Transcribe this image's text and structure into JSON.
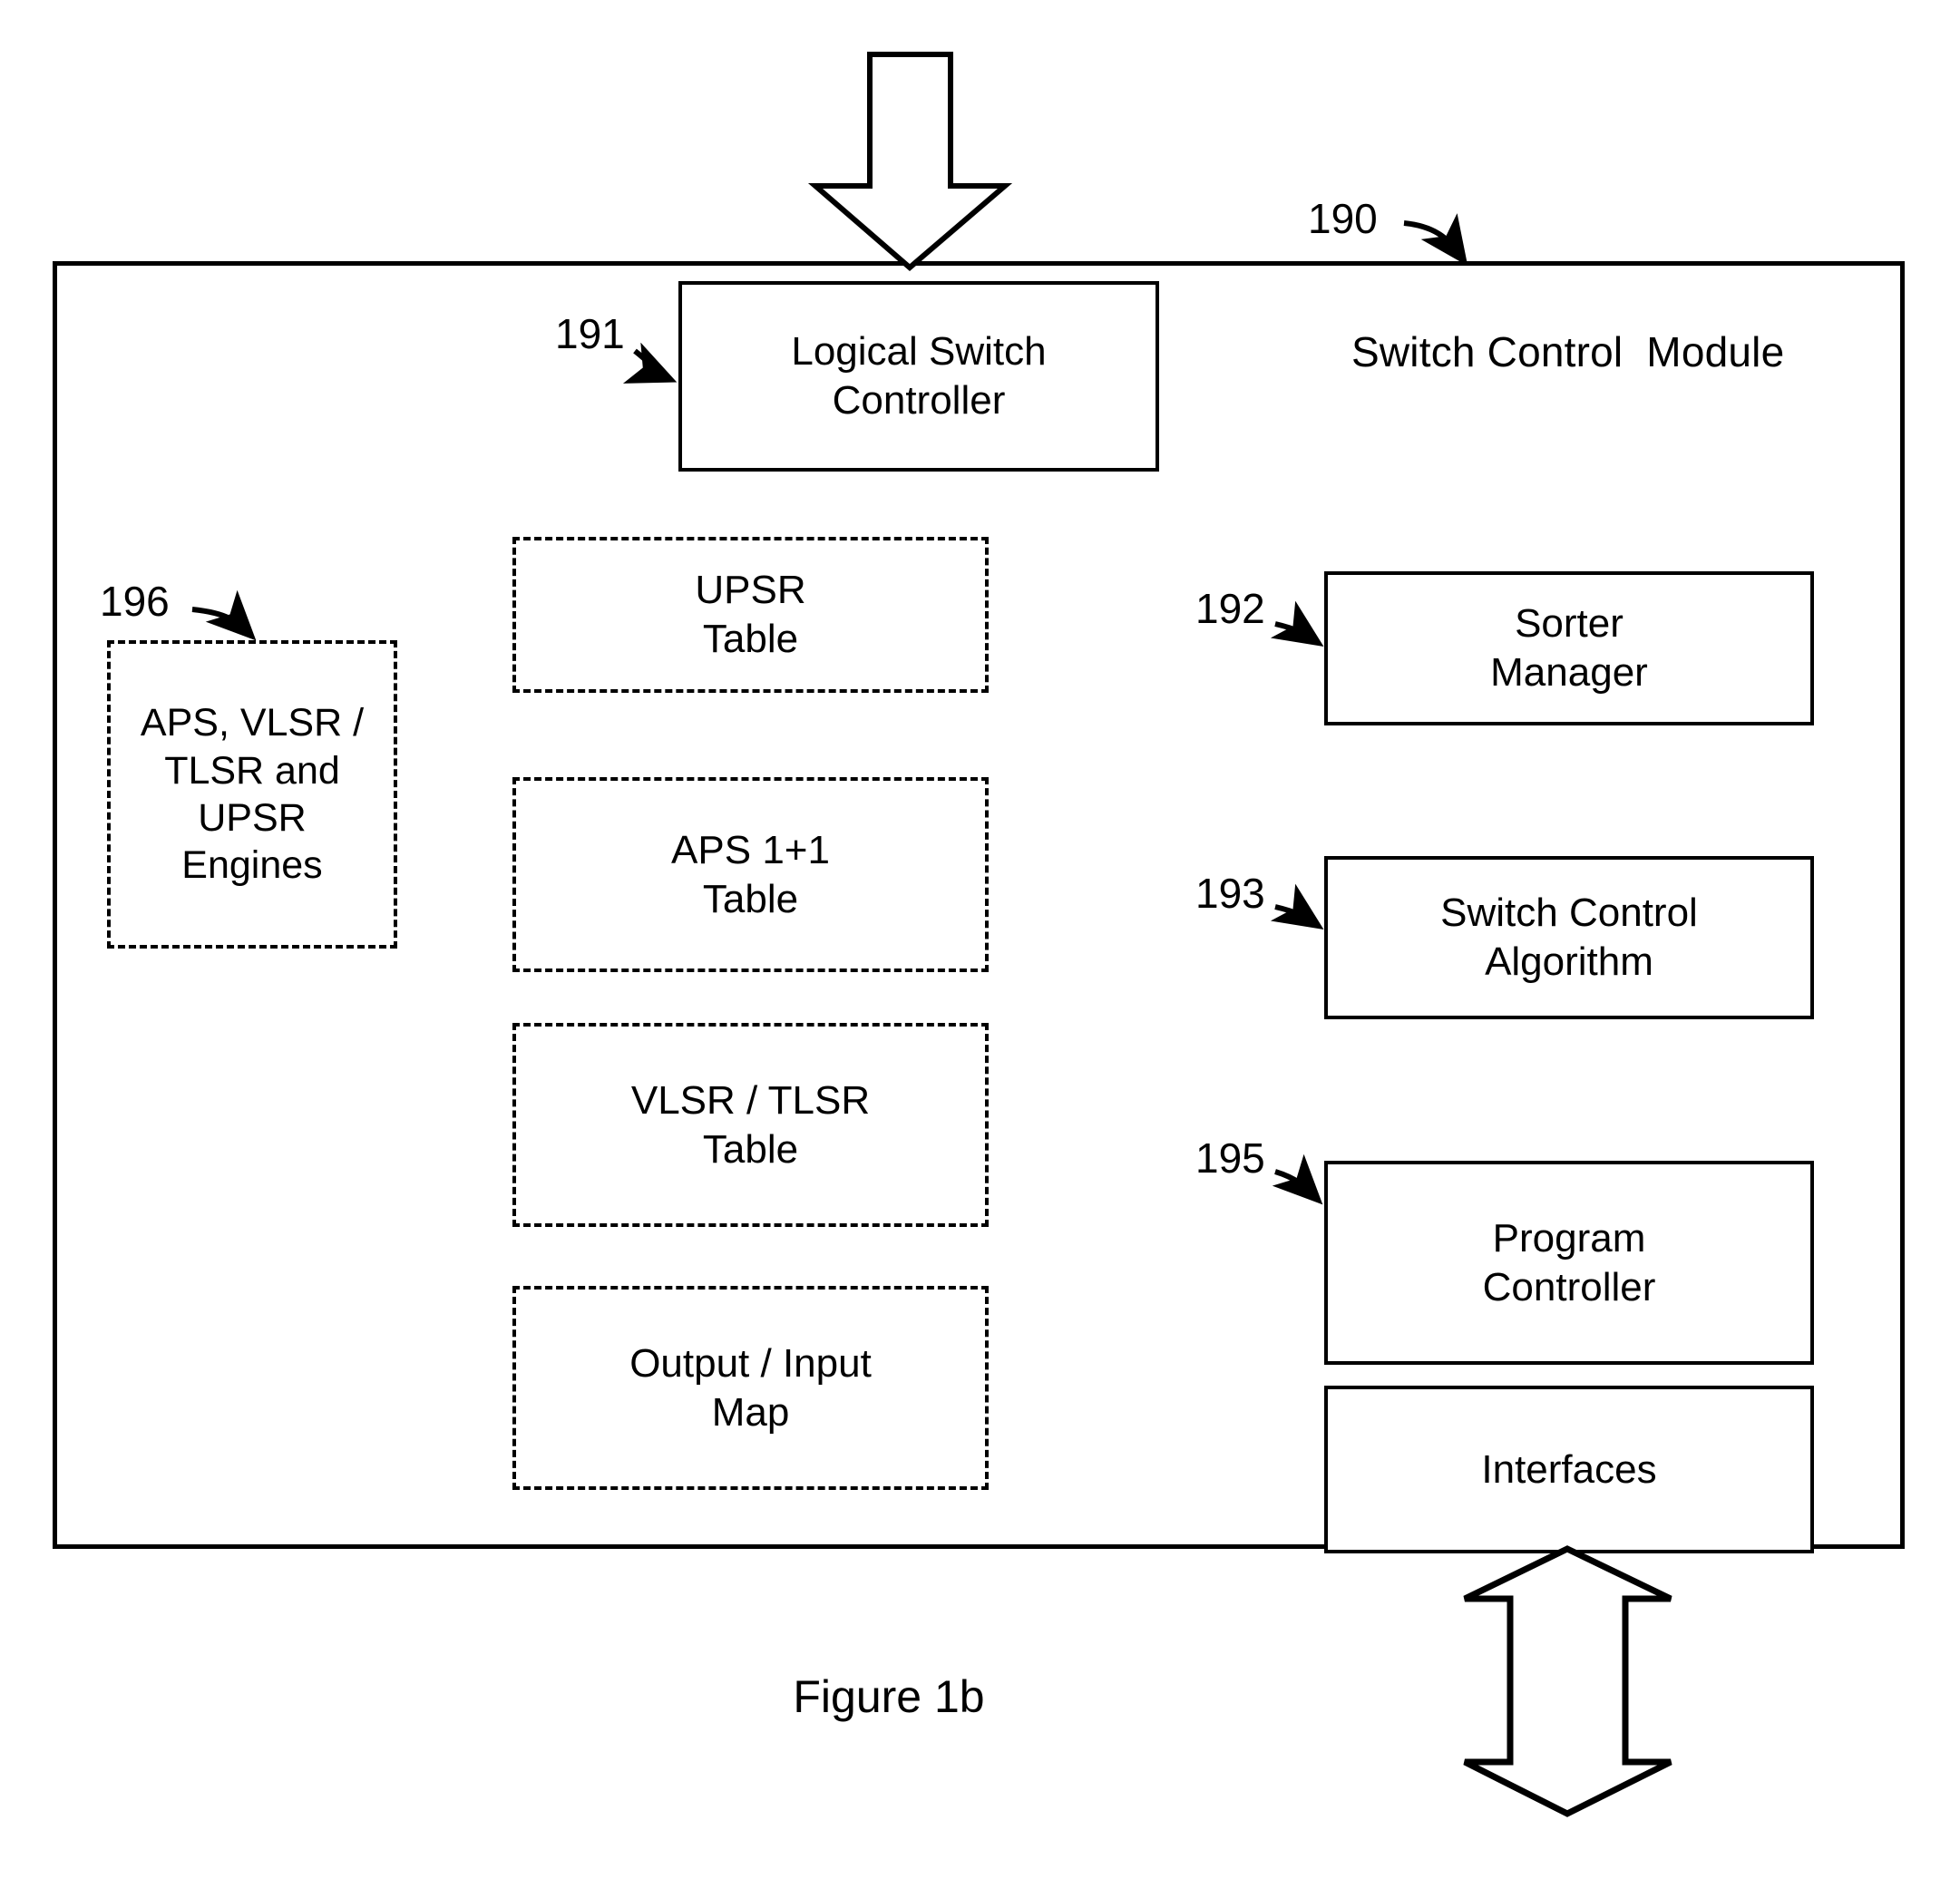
{
  "figure": {
    "caption": "Figure 1b"
  },
  "module": {
    "title": "Switch Control  Module",
    "ref": "190"
  },
  "top_arrow": {
    "name": "down-arrow-into-module",
    "direction": "down"
  },
  "bottom_arrow": {
    "name": "bidirectional-arrow-interfaces",
    "direction": "up-down"
  },
  "blocks": {
    "logical_switch_controller": {
      "label": "Logical Switch\nController",
      "ref": "191"
    },
    "engines": {
      "label": "APS, VLSR /\nTLSR and\nUPSR\nEngines",
      "ref": "196"
    },
    "sorter_manager": {
      "label": "Sorter\nManager",
      "ref": "192"
    },
    "switch_control_algorithm": {
      "label": "Switch Control\nAlgorithm",
      "ref": "193"
    },
    "program_controller": {
      "label": "Program\nController",
      "ref": "195"
    },
    "interfaces": {
      "label": "Interfaces"
    }
  },
  "tables": [
    {
      "label": "UPSR\nTable"
    },
    {
      "label": "APS 1+1\nTable"
    },
    {
      "label": "VLSR / TLSR\nTable"
    },
    {
      "label": "Output / Input\nMap"
    }
  ],
  "colors": {
    "stroke": "#000000",
    "background": "#ffffff"
  }
}
